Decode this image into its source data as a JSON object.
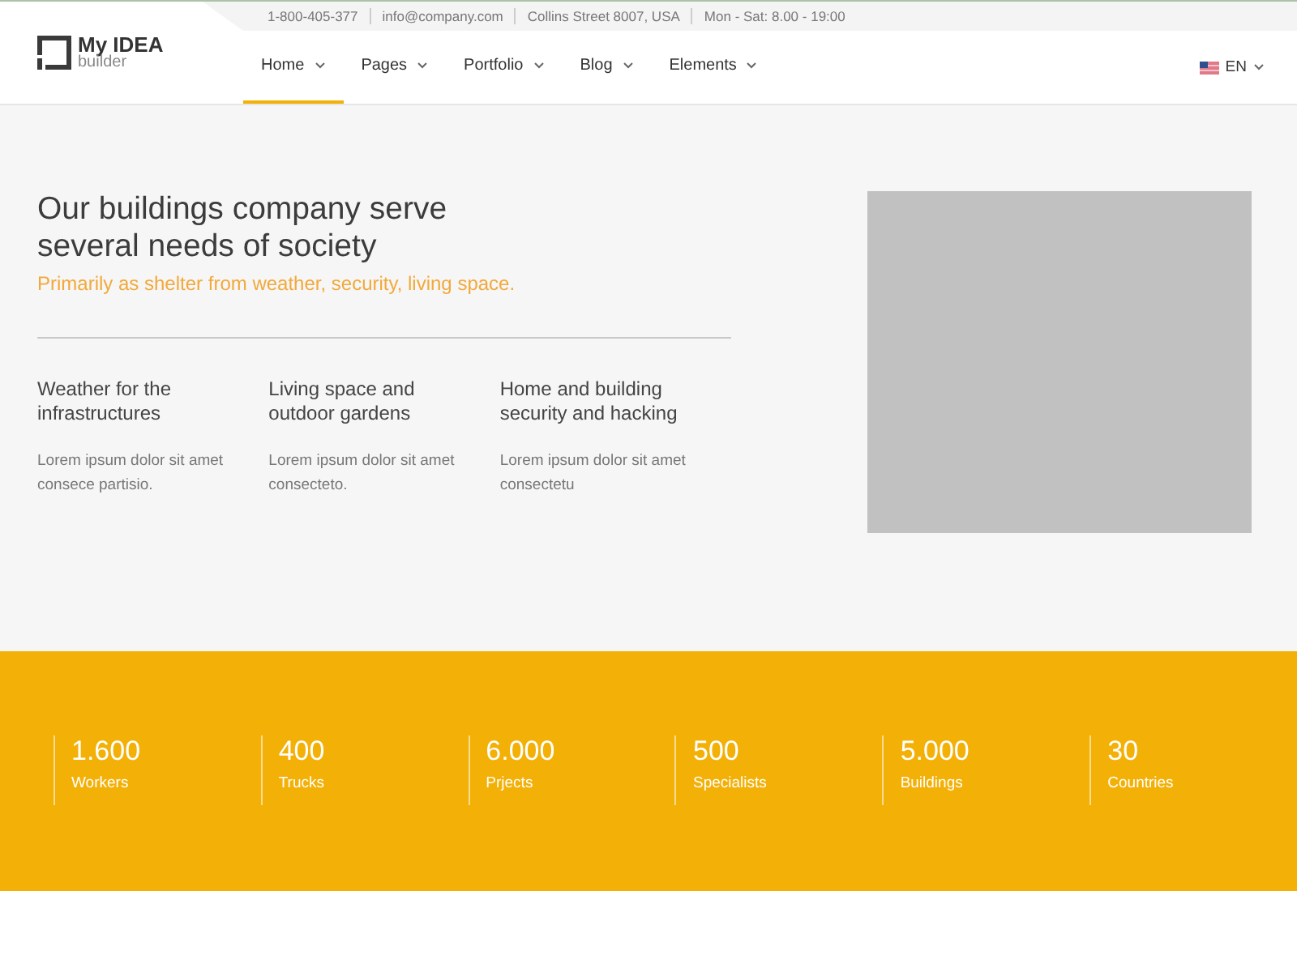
{
  "logo": {
    "title": "My IDEA",
    "subtitle": "builder"
  },
  "topbar": [
    "1-800-405-377",
    "info@company.com",
    "Collins Street 8007, USA",
    "Mon - Sat: 8.00 - 19:00"
  ],
  "nav": [
    {
      "label": "Home",
      "selected": true
    },
    {
      "label": "Pages",
      "selected": false
    },
    {
      "label": "Portfolio",
      "selected": false
    },
    {
      "label": "Blog",
      "selected": false
    },
    {
      "label": "Elements",
      "selected": false
    }
  ],
  "language": "EN",
  "hero": {
    "title": "Our buildings company serve several needs of society",
    "subtitle": "Primarily as shelter from weather, security, living space.",
    "features": [
      {
        "title": "Weather for the infrastructures",
        "text": "Lorem ipsum dolor sit amet consece partisio."
      },
      {
        "title": "Living space and outdoor gardens",
        "text": "Lorem ipsum dolor sit amet consecteto."
      },
      {
        "title": "Home and building security and hacking",
        "text": "Lorem ipsum dolor sit amet consectetu"
      }
    ]
  },
  "stats": [
    {
      "value": "1.600",
      "label": "Workers"
    },
    {
      "value": "400",
      "label": "Trucks"
    },
    {
      "value": "6.000",
      "label": "Prjects"
    },
    {
      "value": "500",
      "label": "Specialists"
    },
    {
      "value": "5.000",
      "label": "Buildings"
    },
    {
      "value": "30",
      "label": "Countries"
    }
  ]
}
